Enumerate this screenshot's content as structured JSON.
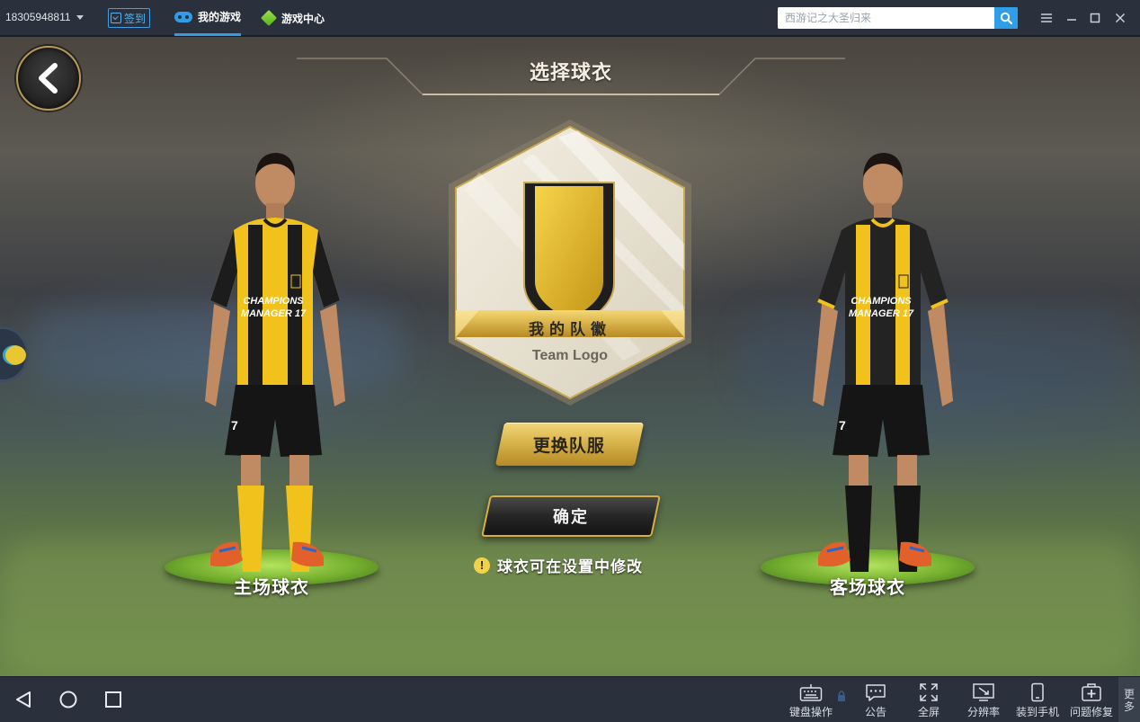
{
  "titlebar": {
    "account": "18305948811",
    "signin": "签到",
    "tabs": [
      {
        "label": "我的游戏"
      },
      {
        "label": "游戏中心"
      }
    ],
    "search_placeholder": "西游记之大圣归来"
  },
  "game": {
    "title": "选择球衣",
    "home_kit_label": "主场球衣",
    "away_kit_label": "客场球衣",
    "shirt_text_line1": "CHAMPIONS",
    "shirt_text_line2": "MANAGER 17",
    "shirt_number": "7",
    "emblem_title": "我的队徽",
    "emblem_subtitle": "Team Logo",
    "change_kit_button": "更换队服",
    "confirm_button": "确定",
    "hint": "球衣可在设置中修改",
    "colors": {
      "gold": "#d9b44c",
      "kit_yellow": "#f1c21b",
      "kit_black": "#1c1c1c"
    }
  },
  "bottombar": {
    "tools": [
      {
        "label": "键盘操作",
        "icon": "keyboard-icon"
      },
      {
        "label": "公告",
        "icon": "announcement-icon"
      },
      {
        "label": "全屏",
        "icon": "fullscreen-icon"
      },
      {
        "label": "分辨率",
        "icon": "resolution-icon"
      },
      {
        "label": "装到手机",
        "icon": "install-to-phone-icon"
      },
      {
        "label": "问题修复",
        "icon": "repair-icon"
      }
    ],
    "more": "更多"
  }
}
